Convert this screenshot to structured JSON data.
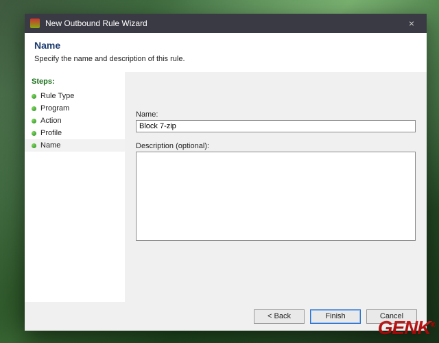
{
  "window": {
    "title": "New Outbound Rule Wizard"
  },
  "header": {
    "title": "Name",
    "subtitle": "Specify the name and description of this rule."
  },
  "steps": {
    "heading": "Steps:",
    "items": [
      {
        "label": "Rule Type"
      },
      {
        "label": "Program"
      },
      {
        "label": "Action"
      },
      {
        "label": "Profile"
      },
      {
        "label": "Name"
      }
    ],
    "current_index": 4
  },
  "form": {
    "name_label": "Name:",
    "name_value": "Block 7-zip",
    "desc_label": "Description (optional):",
    "desc_value": ""
  },
  "buttons": {
    "back": "< Back",
    "finish": "Finish",
    "cancel": "Cancel"
  },
  "watermark": "GENK"
}
